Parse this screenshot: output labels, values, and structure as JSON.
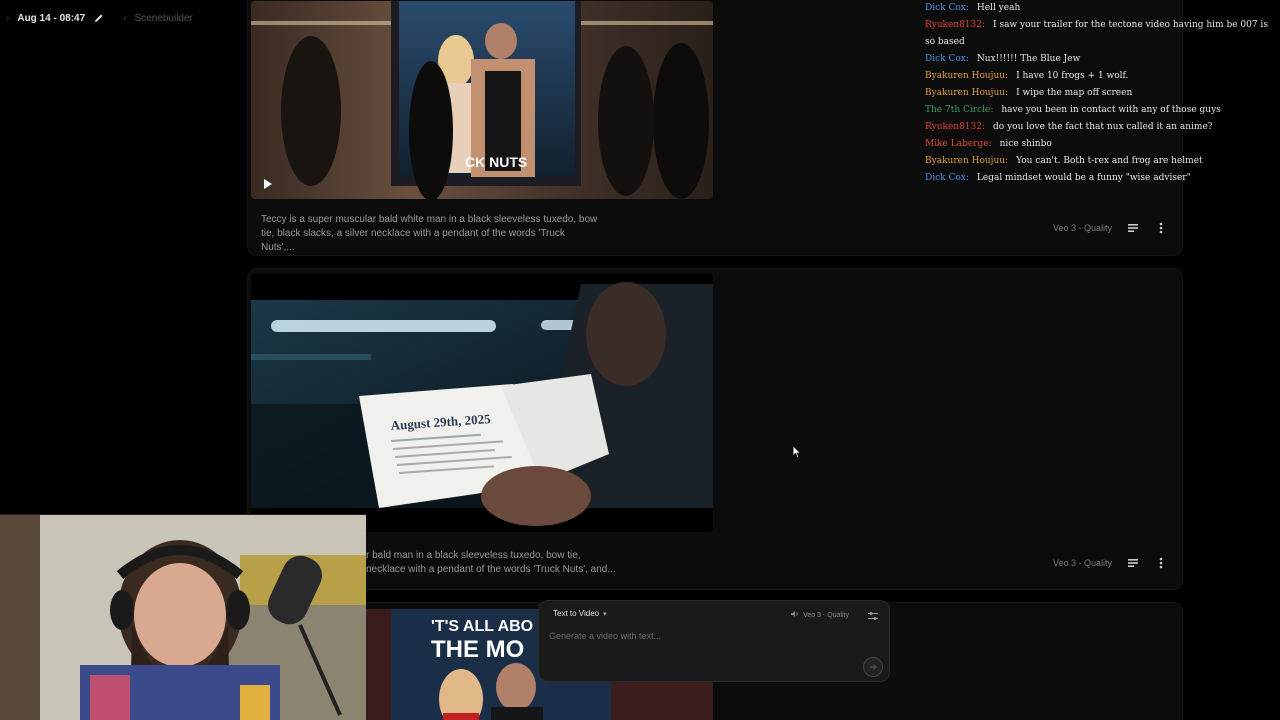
{
  "header": {
    "date": "Aug 14 - 08:47",
    "project": "Scenebuilder"
  },
  "cards": [
    {
      "prompt": "Teccy is a super muscular bald white man in a black sleeveless tuxedo, bow tie, black slacks, a silver necklace with a pendant of the words 'Truck Nuts',...",
      "model": "Veo 3 - Quality",
      "poster_text": "CK NUTS"
    },
    {
      "prompt": "Teccy is a super muscular bald white man in a black sleeveless tuxedo, bow tie, black slacks, a silver necklace with a pendant of the words 'Truck Nuts', and...",
      "prompt_visible": "r bald man in a black sleeveless tuxedo, bow tie,\nnecklace with a pendant of the words 'Truck Nuts', and...",
      "model": "Veo 3 - Quality",
      "document_text": "August 29th, 2025"
    },
    {
      "poster_text_line1": "'T'S ALL ABO",
      "poster_text_line2": "THE MO"
    }
  ],
  "chat": [
    {
      "user": "Dick Cox",
      "color": "#4a90e2",
      "text": "Hell yeah"
    },
    {
      "user": "Ryuken8132",
      "color": "#e0423a",
      "text": "I saw your trailer for the tectone video having him be 007 is so based"
    },
    {
      "user": "Dick Cox",
      "color": "#4a90e2",
      "text": "Nux!!!!!! The Blue Jew"
    },
    {
      "user": "Byakuren Houjuu",
      "color": "#e0a040",
      "text": "I have 10 frogs + 1 wolf."
    },
    {
      "user": "Byakuren Houjuu",
      "color": "#e0a040",
      "text": "I wipe the map off screen"
    },
    {
      "user": "The 7th Circle",
      "color": "#3aa35a",
      "text": "have you been in contact with any of those guys"
    },
    {
      "user": "Ryuken8132",
      "color": "#e0423a",
      "text": "do you love the fact that nux called it an anime?"
    },
    {
      "user": "Mike Laberge",
      "color": "#e04a3a",
      "text": "nice shinbo"
    },
    {
      "user": "Byakuren Houjuu",
      "color": "#e0a040",
      "text": "You can't. Both t-rex and frog are helmet"
    },
    {
      "user": "Dick Cox",
      "color": "#4a90e2",
      "text": "Legal mindset would be a funny \"wise adviser\""
    }
  ],
  "composer": {
    "mode": "Text to Video",
    "model": "Veo 3 - Quality",
    "placeholder": "Generate a video with text..."
  }
}
